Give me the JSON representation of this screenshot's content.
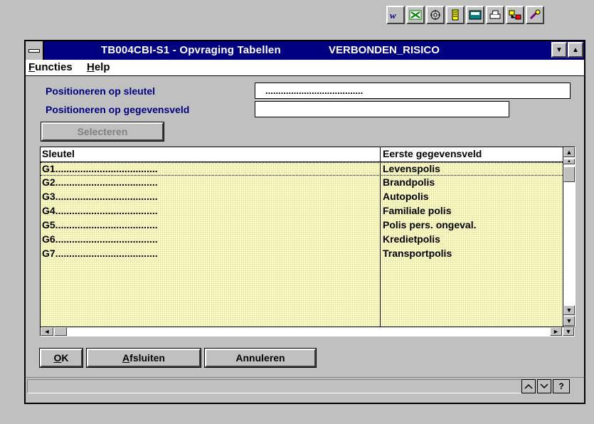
{
  "window": {
    "title": "TB004CBI-S1 - Opvraging Tabellen",
    "table_name": "VERBONDEN_RISICO"
  },
  "menu": [
    {
      "label_u": "F",
      "label_rest": "uncties"
    },
    {
      "label_u": "H",
      "label_rest": "elp"
    }
  ],
  "form": {
    "label_key": "Positioneren op sleutel",
    "key_value": "......................................",
    "label_data": "Positioneren op gegevensveld",
    "data_value": "",
    "select_button": "Selecteren"
  },
  "grid": {
    "headers": [
      "Sleutel",
      "Eerste gegevensveld"
    ],
    "rows": [
      [
        "G1.....................................",
        "Levenspolis"
      ],
      [
        "G2.....................................",
        "Brandpolis"
      ],
      [
        "G3.....................................",
        "Autopolis"
      ],
      [
        "G4.....................................",
        "Familiale polis"
      ],
      [
        "G5.....................................",
        "Polis pers. ongeval."
      ],
      [
        "G6.....................................",
        "Kredietpolis"
      ],
      [
        "G7.....................................",
        "Transportpolis"
      ]
    ]
  },
  "buttons": {
    "ok_u": "O",
    "ok_rest": "K",
    "close_u": "A",
    "close_rest": "fsluiten",
    "cancel": "Annuleren"
  },
  "status": {
    "help": "?"
  },
  "icons": {
    "toolbar": [
      "word-icon",
      "excel-icon",
      "gear-icon",
      "notepad-icon",
      "calculator-icon",
      "printer-icon",
      "network-icon",
      "tools-icon"
    ]
  }
}
